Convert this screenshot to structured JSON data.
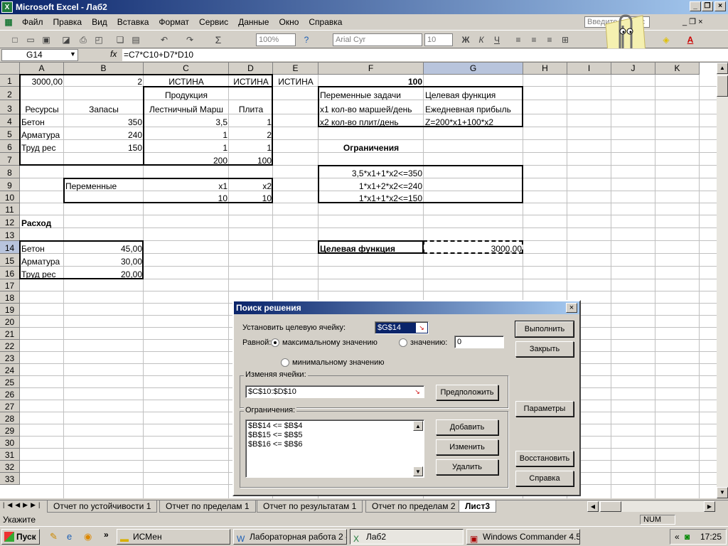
{
  "window": {
    "title": "Microsoft Excel - Лаб2",
    "app_icon": "excel-icon"
  },
  "menu": [
    "Файл",
    "Правка",
    "Вид",
    "Вставка",
    "Формат",
    "Сервис",
    "Данные",
    "Окно",
    "Справка"
  ],
  "help_placeholder": "Введите вопрос",
  "toolbar": {
    "zoom": "100%",
    "font": "Arial Cyr",
    "size": "10",
    "sigma": "Σ"
  },
  "formula_bar": {
    "name_box": "G14",
    "fx": "fx",
    "formula": "=C7*C10+D7*D10"
  },
  "columns": [
    "A",
    "B",
    "C",
    "D",
    "E",
    "F",
    "G",
    "H",
    "I",
    "J",
    "K"
  ],
  "rows": [
    "1",
    "2",
    "3",
    "4",
    "5",
    "6",
    "7",
    "8",
    "9",
    "10",
    "11",
    "12",
    "13",
    "14",
    "15",
    "16",
    "17",
    "18",
    "19",
    "20",
    "21",
    "22",
    "23",
    "24",
    "25",
    "26",
    "27",
    "28",
    "29",
    "30",
    "31",
    "32",
    "33"
  ],
  "cells": {
    "A1": "3000,00",
    "B1": "2",
    "C1": "ИСТИНА",
    "D1": "ИСТИНА",
    "E1": "ИСТИНА",
    "F1": "100",
    "C2": "Продукция",
    "F2": "Переменные задачи",
    "G2": "Целевая функция",
    "A3": "Ресурсы",
    "B3": "Запасы",
    "C3": "Лестничный Марш",
    "D3": "Плита",
    "F3": "x1 кол-во маршей/день",
    "G3": "Ежедневная прибыль",
    "A4": "Бетон",
    "B4": "350",
    "C4": "3,5",
    "D4": "1",
    "F4": "x2 кол-во плит/день",
    "G4": "Z=200*x1+100*x2",
    "A5": "Арматура",
    "B5": "240",
    "C5": "1",
    "D5": "2",
    "A6": "Труд рес",
    "B6": "150",
    "C6": "1",
    "D6": "1",
    "F6": "Ограничения",
    "C7": "200",
    "D7": "100",
    "F8": "3,5*x1+1*x2<=350",
    "B9": "Переменные",
    "C9": "x1",
    "D9": "x2",
    "F9": "1*x1+2*x2<=240",
    "C10": "10",
    "D10": "10",
    "F10": "1*x1+1*x2<=150",
    "A12": "Расход",
    "A14": "Бетон",
    "B14": "45,00",
    "F14": "Целевая функция",
    "G14": "3000,00",
    "A15": "Арматура",
    "B15": "30,00",
    "A16": "Труд рес",
    "B16": "20,00"
  },
  "sheet_tabs": [
    "Отчет по устойчивости 1",
    "Отчет по пределам 1",
    "Отчет по результатам 1",
    "Отчет по пределам 2",
    "Лист3"
  ],
  "status": {
    "text": "Укажите",
    "num": "NUM"
  },
  "taskbar": {
    "start": "Пуск",
    "tasks": [
      "ИСМен",
      "Лабораторная работа 2 - ...",
      "Лаб2",
      "Windows Commander 4.5..."
    ],
    "clock": "17:25",
    "more": "»"
  },
  "dialog": {
    "title": "Поиск решения",
    "target_label": "Установить целевую ячейку:",
    "target_value": "$G$14",
    "equal_label": "Равной:",
    "radio_max": "максимальному значению",
    "radio_value": "значению:",
    "value_field": "0",
    "radio_min": "минимальному значению",
    "changing_label": "Изменяя ячейки:",
    "changing_value": "$C$10:$D$10",
    "constraints_label": "Ограничения:",
    "constraints": [
      "$B$14 <= $B$4",
      "$B$15 <= $B$5",
      "$B$16 <= $B$6"
    ],
    "buttons": {
      "solve": "Выполнить",
      "close": "Закрыть",
      "guess": "Предположить",
      "options": "Параметры",
      "add": "Добавить",
      "change": "Изменить",
      "delete": "Удалить",
      "reset": "Восстановить",
      "help": "Справка"
    }
  }
}
